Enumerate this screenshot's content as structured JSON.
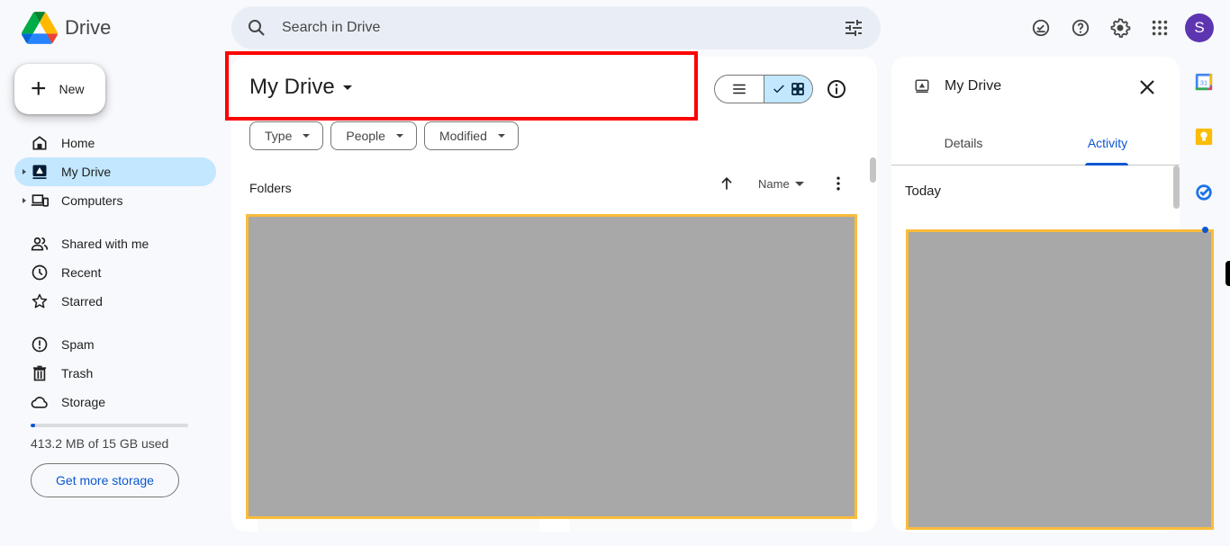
{
  "app": {
    "name": "Drive"
  },
  "search": {
    "placeholder": "Search in Drive",
    "value": ""
  },
  "header_icons": [
    {
      "name": "offline-status-icon"
    },
    {
      "name": "help-icon"
    },
    {
      "name": "settings-icon"
    },
    {
      "name": "apps-grid-icon"
    }
  ],
  "account": {
    "initial": "S",
    "color": "#5e35b1"
  },
  "sidebar": {
    "new_label": "New",
    "items": [
      {
        "label": "Home",
        "icon": "home-icon",
        "active": false
      },
      {
        "label": "My Drive",
        "icon": "my-drive-icon",
        "active": true,
        "expandable": true
      },
      {
        "label": "Computers",
        "icon": "computers-icon",
        "active": false,
        "expandable": true
      },
      {
        "label": "Shared with me",
        "icon": "shared-icon",
        "active": false
      },
      {
        "label": "Recent",
        "icon": "clock-icon",
        "active": false
      },
      {
        "label": "Starred",
        "icon": "star-icon",
        "active": false
      },
      {
        "label": "Spam",
        "icon": "spam-icon",
        "active": false
      },
      {
        "label": "Trash",
        "icon": "trash-icon",
        "active": false
      },
      {
        "label": "Storage",
        "icon": "cloud-icon",
        "active": false
      }
    ],
    "storage": {
      "used_text": "413.2 MB of 15 GB used",
      "used_fraction": 0.027,
      "button_label": "Get more storage"
    }
  },
  "main": {
    "title": "My Drive",
    "view_mode": "grid",
    "filters": [
      {
        "label": "Type"
      },
      {
        "label": "People"
      },
      {
        "label": "Modified"
      }
    ],
    "section_label": "Folders",
    "sort": {
      "field": "Name",
      "direction": "ascending"
    }
  },
  "details_panel": {
    "title": "My Drive",
    "tabs": [
      {
        "label": "Details",
        "selected": false
      },
      {
        "label": "Activity",
        "selected": true
      }
    ],
    "group_label": "Today"
  },
  "side_apps": [
    {
      "name": "calendar",
      "label": "31"
    },
    {
      "name": "keep"
    },
    {
      "name": "tasks"
    }
  ],
  "colors": {
    "accent": "#0b57d0",
    "active_nav": "#c2e7ff",
    "highlight_outline": "#ff0000",
    "redaction_border": "#fbbc3a"
  }
}
